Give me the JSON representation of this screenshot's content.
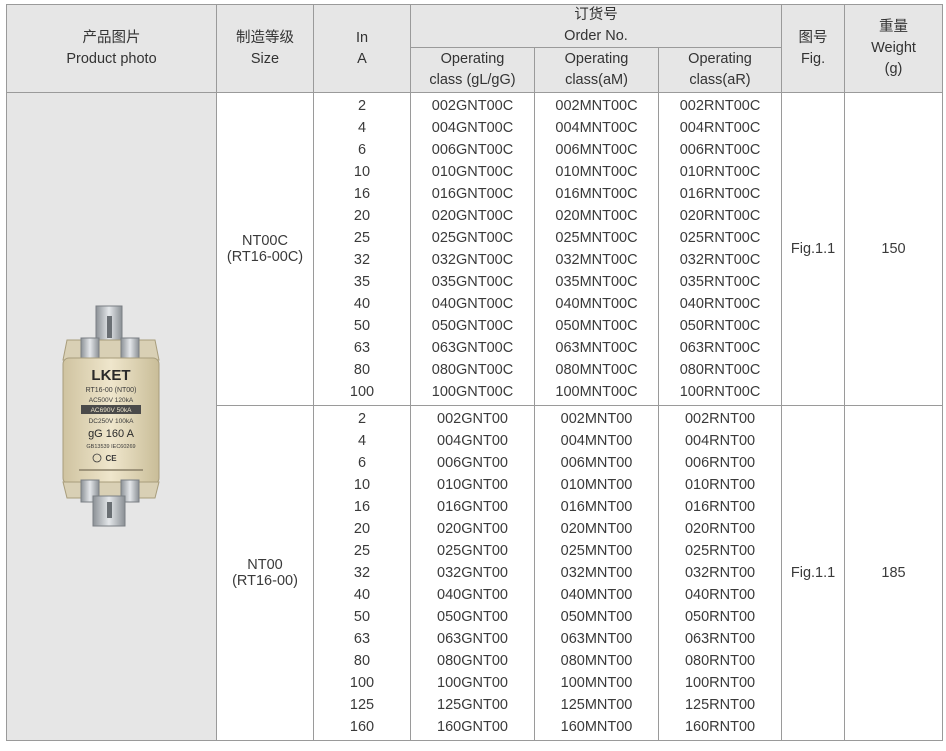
{
  "header": {
    "photo_cn": "产品图片",
    "photo_en": "Product photo",
    "size_cn": "制造等级",
    "size_en": "Size",
    "in_line1": "In",
    "in_line2": "A",
    "order_cn": "订货号",
    "order_en": "Order No.",
    "op_gl_1": "Operating",
    "op_gl_2": "class (gL/gG)",
    "op_am_1": "Operating",
    "op_am_2": "class(aM)",
    "op_ar_1": "Operating",
    "op_ar_2": "class(aR)",
    "fig_cn": "图号",
    "fig_en": "Fig.",
    "weight_cn": "重量",
    "weight_en": "Weight",
    "weight_unit": "(g)"
  },
  "fuse_label": {
    "brand": "LKET",
    "model": "RT16-00 (NT00)",
    "ac": "AC500V 120kA",
    "ac2": "AC690V 50kA",
    "dc": "DC250V 100kA",
    "rating": "gG 160 A",
    "std": "GB13539  IEC60269"
  },
  "groups": [
    {
      "size": "NT00C",
      "size_alt": "(RT16-00C)",
      "fig": "Fig.1.1",
      "weight": "150",
      "currents": [
        "2",
        "4",
        "6",
        "10",
        "16",
        "20",
        "25",
        "32",
        "35",
        "40",
        "50",
        "63",
        "80",
        "100"
      ],
      "gl": [
        "002GNT00C",
        "004GNT00C",
        "006GNT00C",
        "010GNT00C",
        "016GNT00C",
        "020GNT00C",
        "025GNT00C",
        "032GNT00C",
        "035GNT00C",
        "040GNT00C",
        "050GNT00C",
        "063GNT00C",
        "080GNT00C",
        "100GNT00C"
      ],
      "am": [
        "002MNT00C",
        "004MNT00C",
        "006MNT00C",
        "010MNT00C",
        "016MNT00C",
        "020MNT00C",
        "025MNT00C",
        "032MNT00C",
        "035MNT00C",
        "040MNT00C",
        "050MNT00C",
        "063MNT00C",
        "080MNT00C",
        "100MNT00C"
      ],
      "ar": [
        "002RNT00C",
        "004RNT00C",
        "006RNT00C",
        "010RNT00C",
        "016RNT00C",
        "020RNT00C",
        "025RNT00C",
        "032RNT00C",
        "035RNT00C",
        "040RNT00C",
        "050RNT00C",
        "063RNT00C",
        "080RNT00C",
        "100RNT00C"
      ]
    },
    {
      "size": "NT00",
      "size_alt": "(RT16-00)",
      "fig": "Fig.1.1",
      "weight": "185",
      "currents": [
        "2",
        "4",
        "6",
        "10",
        "16",
        "20",
        "25",
        "32",
        "40",
        "50",
        "63",
        "80",
        "100",
        "125",
        "160"
      ],
      "gl": [
        "002GNT00",
        "004GNT00",
        "006GNT00",
        "010GNT00",
        "016GNT00",
        "020GNT00",
        "025GNT00",
        "032GNT00",
        "040GNT00",
        "050GNT00",
        "063GNT00",
        "080GNT00",
        "100GNT00",
        "125GNT00",
        "160GNT00"
      ],
      "am": [
        "002MNT00",
        "004MNT00",
        "006MNT00",
        "010MNT00",
        "016MNT00",
        "020MNT00",
        "025MNT00",
        "032MNT00",
        "040MNT00",
        "050MNT00",
        "063MNT00",
        "080MNT00",
        "100MNT00",
        "125MNT00",
        "160MNT00"
      ],
      "ar": [
        "002RNT00",
        "004RNT00",
        "006RNT00",
        "010RNT00",
        "016RNT00",
        "020RNT00",
        "025RNT00",
        "032RNT00",
        "040RNT00",
        "050RNT00",
        "063RNT00",
        "080RNT00",
        "100RNT00",
        "125RNT00",
        "160RNT00"
      ]
    }
  ]
}
